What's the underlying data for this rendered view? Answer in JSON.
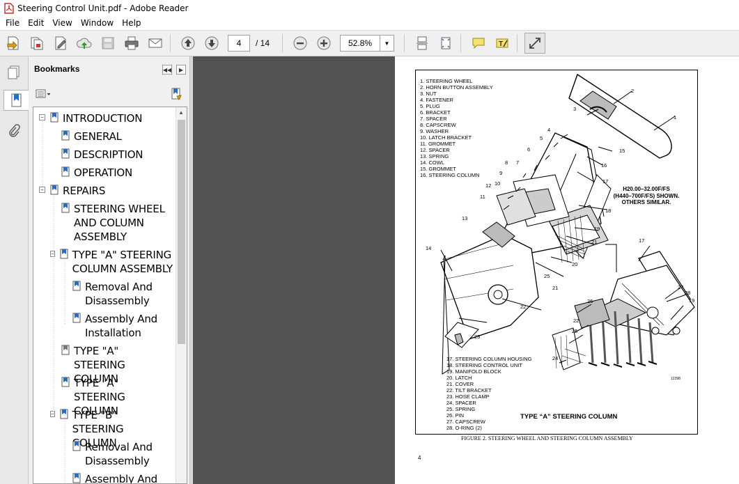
{
  "window": {
    "title": "Steering Control Unit.pdf - Adobe Reader"
  },
  "menu": [
    "File",
    "Edit",
    "View",
    "Window",
    "Help"
  ],
  "toolbar": {
    "page_current": "4",
    "page_total": "/ 14",
    "zoom": "52.8%"
  },
  "bookmarks": {
    "title": "Bookmarks",
    "items": [
      {
        "label": "INTRODUCTION",
        "level": 0,
        "toggle": "−"
      },
      {
        "label": "GENERAL",
        "level": 1
      },
      {
        "label": "DESCRIPTION",
        "level": 1
      },
      {
        "label": "OPERATION",
        "level": 1
      },
      {
        "label": "REPAIRS",
        "level": 0,
        "toggle": "−"
      },
      {
        "label": "STEERING WHEEL AND COLUMN ASSEMBLY",
        "level": 1
      },
      {
        "label": "TYPE \"A\" STEERING COLUMN ASSEMBLY",
        "level": 1,
        "toggle": "−"
      },
      {
        "label": "Removal And Disassembly",
        "level": 2
      },
      {
        "label": "Assembly And Installation",
        "level": 2
      },
      {
        "label": "TYPE \"A\" STEERING COLUMN",
        "level": 1
      },
      {
        "label": "TYPE \"A\" STEERING COLUMN",
        "level": 1
      },
      {
        "label": "TYPE \"B\" STEERING COLUMN",
        "level": 1,
        "toggle": "−"
      },
      {
        "label": "Removal And Disassembly",
        "level": 2
      },
      {
        "label": "Assembly And",
        "level": 2
      }
    ]
  },
  "document": {
    "legend_top": [
      "1. STEERING WHEEL",
      "2. HORN BUTTON ASSEMBLY",
      "3. NUT",
      "4. FASTENER",
      "5. PLUG",
      "6. BRACKET",
      "7. SPACER",
      "8. CAPSCREW",
      "9. WASHER",
      "10. LATCH BRACKET",
      "11. GROMMET",
      "12. SPACER",
      "13. SPRING",
      "14. COWL",
      "15. GROMMET",
      "16. STEERING COLUMN"
    ],
    "legend_bottom": [
      "17. STEERING COLUMN HOUSING",
      "18. STEERING CONTROL UNIT",
      "19. MANIFOLD BLOCK",
      "20. LATCH",
      "21. COVER",
      "22. TILT BRACKET",
      "23. HOSE CLAMP",
      "24. SPACER",
      "25. SPRING",
      "26. PIN",
      "27. CAPSCREW",
      "28. O-RING (2)"
    ],
    "model_note": [
      "H20.00–32.00F/FS",
      "(H440–700F/FS) SHOWN.",
      "OTHERS SIMILAR."
    ],
    "figure_title": "TYPE “A” STEERING COLUMN",
    "figure_caption": "FIGURE 2. STEERING WHEEL AND STEERING COLUMN ASSEMBLY",
    "image_number": "12398",
    "page_number": "4",
    "callouts": [
      "1",
      "2",
      "3",
      "4",
      "5",
      "6",
      "7",
      "8",
      "9",
      "10",
      "11",
      "12",
      "13",
      "14",
      "15",
      "16",
      "17",
      "18",
      "19",
      "20",
      "21",
      "22",
      "23",
      "24",
      "25",
      "26",
      "27",
      "28"
    ]
  }
}
